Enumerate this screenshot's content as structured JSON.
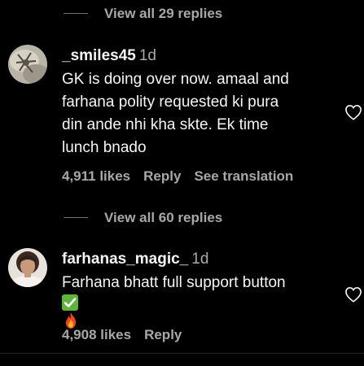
{
  "thread_top": {
    "view_replies_label": "View all 29 replies"
  },
  "comments": [
    {
      "username": "_smiles45",
      "age": "1d",
      "text_lines": [
        "GK is doing over now. amaal and",
        "farhana polity requested ki pura",
        "din ande nhi kha skte. Ek time",
        "lunch bnado"
      ],
      "likes": "4,911 likes",
      "reply_label": "Reply",
      "translate_label": "See translation",
      "view_replies_label": "View all 60 replies"
    },
    {
      "username": "farhanas_magic_",
      "age": "1d",
      "text_lines": [
        "Farhana bhatt full support button"
      ],
      "emojis": [
        "check-mark-emoji",
        "fire-emoji"
      ],
      "likes": "4,908 likes",
      "reply_label": "Reply"
    }
  ],
  "icons": {
    "like": "heart-outline-icon"
  },
  "colors": {
    "background": "#000000",
    "primary_text": "#f5f5f5",
    "secondary_text": "#a8a8a8"
  }
}
